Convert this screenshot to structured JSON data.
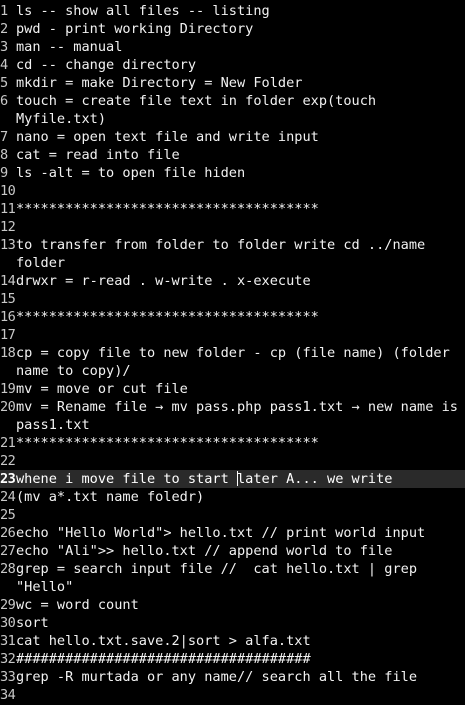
{
  "editor": {
    "current_line": "23",
    "lines": [
      {
        "n": "1",
        "text": "ls -- show all files -- listing"
      },
      {
        "n": "2",
        "text": "pwd - print working Directory"
      },
      {
        "n": "3",
        "text": "man -- manual"
      },
      {
        "n": "4",
        "text": "cd -- change directory"
      },
      {
        "n": "5",
        "text": "mkdir = make Directory = New Folder"
      },
      {
        "n": "6",
        "text": "touch = create file text in folder exp(touch Myfile.txt)"
      },
      {
        "n": "7",
        "text": "nano = open text file and write input"
      },
      {
        "n": "8",
        "text": "cat = read into file"
      },
      {
        "n": "9",
        "text": "ls -alt = to open file hiden"
      },
      {
        "n": "10",
        "text": ""
      },
      {
        "n": "11",
        "text": "*************************************"
      },
      {
        "n": "12",
        "text": ""
      },
      {
        "n": "13",
        "text": "to transfer from folder to folder write cd ../name folder"
      },
      {
        "n": "14",
        "text": "drwxr = r-read . w-write . x-execute"
      },
      {
        "n": "15",
        "text": ""
      },
      {
        "n": "16",
        "text": "*************************************"
      },
      {
        "n": "17",
        "text": ""
      },
      {
        "n": "18",
        "text": "cp = copy file to new folder - cp (file name) (folder name to copy)/"
      },
      {
        "n": "19",
        "text": "mv = move or cut file"
      },
      {
        "n": "20",
        "text": "mv = Rename file → mv pass.php pass1.txt → new name is pass1.txt"
      },
      {
        "n": "21",
        "text": "*************************************"
      },
      {
        "n": "22",
        "text": ""
      },
      {
        "n": "23",
        "text_before_cursor": "whene i move file to start ",
        "text_after_cursor": "later A... we write"
      },
      {
        "n": "24",
        "text": "(mv a*.txt name foledr)"
      },
      {
        "n": "25",
        "text": ""
      },
      {
        "n": "26",
        "text": "echo \"Hello World\"> hello.txt // print world input file"
      },
      {
        "n": "27",
        "text": "echo \"Ali\">> hello.txt // append world to file"
      },
      {
        "n": "28",
        "text": "grep = search input file //  cat hello.txt | grep \"Hello\""
      },
      {
        "n": "29",
        "text": "wc = word count"
      },
      {
        "n": "30",
        "text": "sort"
      },
      {
        "n": "31",
        "text": "cat hello.txt.save.2|sort > alfa.txt"
      },
      {
        "n": "32",
        "text": "####################################"
      },
      {
        "n": "33",
        "text": "grep -R murtada or any name// search all the file"
      },
      {
        "n": "34",
        "text": ""
      }
    ]
  },
  "colors": {
    "background": "#000000",
    "text": "#f2f2f2",
    "line_number": "#c8c8c8",
    "current_line_bg": "#2a2a2a"
  }
}
